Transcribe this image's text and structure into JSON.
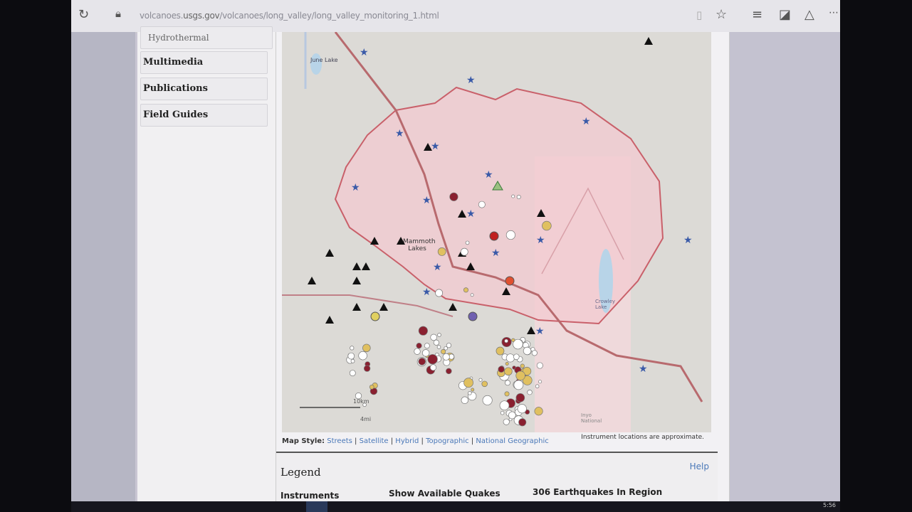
{
  "browser": {
    "url_prefix": "volcanoes.",
    "url_domain": "usgs.gov",
    "url_path": "/volcanoes/long_valley/long_valley_monitoring_1.html"
  },
  "nav": {
    "items": [
      {
        "label": "Hydrothermal"
      },
      {
        "label": "Multimedia"
      },
      {
        "label": "Publications"
      },
      {
        "label": "Field Guides"
      }
    ]
  },
  "map": {
    "labels": {
      "june_lake": "June Lake",
      "mammoth_lakes": "Mammoth Lakes",
      "crowley_lake": "Crowley Lake",
      "inyo": "Inyo National",
      "scale_km": "10km",
      "scale_mi": "4mi"
    },
    "style_label": "Map Style:",
    "styles": [
      "Streets",
      "Satellite",
      "Hybrid",
      "Topographic",
      "National Geographic"
    ],
    "note": "Instrument locations are approximate."
  },
  "legend": {
    "title": "Legend",
    "help": "Help",
    "instruments": "Instruments",
    "show_quakes": "Show Available Quakes",
    "quake_count": "306 Earthquakes In Region"
  },
  "taskbar": {
    "clock": "5:56"
  },
  "colors": {
    "caldera_fill": "#f3c9d0",
    "caldera_stroke": "#c9606a",
    "road": "#b86a6e",
    "star": "#3a5aa8",
    "link": "#4a78b8"
  }
}
